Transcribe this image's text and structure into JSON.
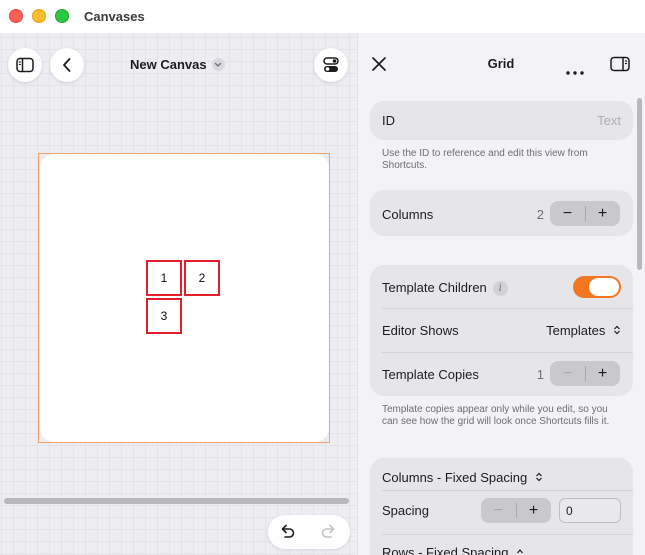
{
  "window": {
    "title": "Canvases"
  },
  "canvas": {
    "title": "New Canvas",
    "cells": [
      "1",
      "2",
      "3"
    ]
  },
  "inspector": {
    "title": "Grid",
    "id_field": {
      "label": "ID",
      "placeholder": "Text"
    },
    "id_note": "Use the ID to reference and edit this view from Shortcuts.",
    "columns": {
      "label": "Columns",
      "value": "2"
    },
    "template_children": {
      "label": "Template Children",
      "enabled": true
    },
    "editor_shows": {
      "label": "Editor Shows",
      "value": "Templates"
    },
    "template_copies": {
      "label": "Template Copies",
      "value": "1"
    },
    "template_note": "Template copies appear only while you edit, so you can see how the grid will look once Shortcuts fills it.",
    "columns_spacing": {
      "label": "Columns - Fixed Spacing"
    },
    "spacing": {
      "label": "Spacing",
      "value": "0"
    },
    "rows_spacing": {
      "label": "Rows - Fixed Spacing"
    }
  },
  "colors": {
    "accent": "#f47621",
    "cell_border": "#e3202a",
    "selection": "#f0a36c"
  }
}
